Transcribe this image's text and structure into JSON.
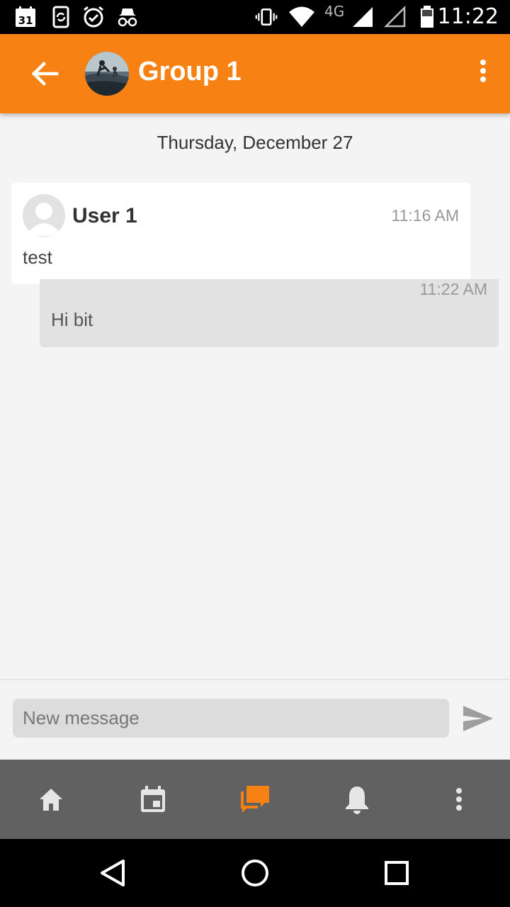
{
  "status_bar": {
    "calendar_date": "31",
    "network": "4G",
    "time": "11:22",
    "icons": [
      "calendar-icon",
      "sync-icon",
      "check-clock-icon",
      "incognito-icon",
      "vibrate-icon",
      "wifi-icon",
      "signal-icon",
      "signal-empty-icon",
      "battery-icon"
    ]
  },
  "app_bar": {
    "title": "Group 1",
    "color": "#f78112",
    "back_icon": "arrow-back-icon",
    "menu_icon": "more-vert-icon"
  },
  "chat": {
    "date_separator": "Thursday, December 27",
    "messages": [
      {
        "sender": "User 1",
        "time": "11:16 AM",
        "text": "test",
        "direction": "incoming"
      },
      {
        "time": "11:22 AM",
        "text": "Hi bit",
        "direction": "outgoing"
      }
    ]
  },
  "composer": {
    "placeholder": "New message",
    "send_icon": "send-icon"
  },
  "tab_bar": {
    "tabs": [
      {
        "icon": "home-icon",
        "active": false
      },
      {
        "icon": "calendar-event-icon",
        "active": false
      },
      {
        "icon": "chat-icon",
        "active": true
      },
      {
        "icon": "bell-icon",
        "active": false
      },
      {
        "icon": "more-vert-icon",
        "active": false
      }
    ],
    "active_color": "#f78112",
    "inactive_color": "#e6e6e6"
  },
  "nav_bar": {
    "buttons": [
      "back-triangle-icon",
      "home-circle-icon",
      "recents-square-icon"
    ]
  }
}
